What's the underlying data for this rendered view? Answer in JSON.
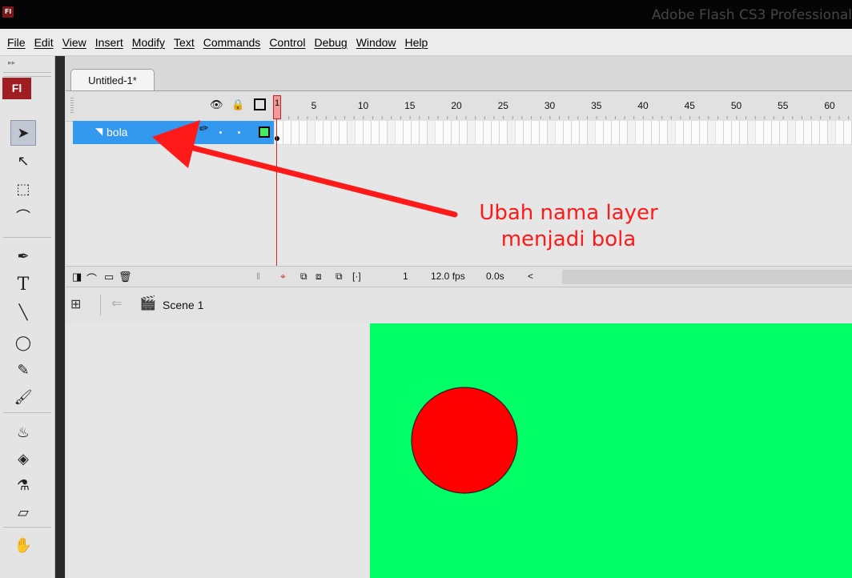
{
  "window": {
    "title": "Adobe Flash CS3 Professional",
    "app_logo": "Fl"
  },
  "menu": {
    "items": [
      "File",
      "Edit",
      "View",
      "Insert",
      "Modify",
      "Text",
      "Commands",
      "Control",
      "Debug",
      "Window",
      "Help"
    ]
  },
  "tools": {
    "logo": "Fl",
    "items": [
      {
        "name": "selection-tool-icon",
        "glyph": "➤",
        "selected": true
      },
      {
        "name": "subselection-tool-icon",
        "glyph": "↖"
      },
      {
        "name": "free-transform-tool-icon",
        "glyph": "⬚"
      },
      {
        "name": "lasso-tool-icon",
        "glyph": "⌒"
      },
      {
        "name": "pen-tool-icon",
        "glyph": "✒"
      },
      {
        "name": "text-tool-icon",
        "glyph": "T"
      },
      {
        "name": "line-tool-icon",
        "glyph": "╲"
      },
      {
        "name": "oval-tool-icon",
        "glyph": "◯"
      },
      {
        "name": "pencil-tool-icon",
        "glyph": "✎"
      },
      {
        "name": "brush-tool-icon",
        "glyph": "🖌"
      },
      {
        "name": "ink-bottle-tool-icon",
        "glyph": "♨"
      },
      {
        "name": "paint-bucket-tool-icon",
        "glyph": "◈"
      },
      {
        "name": "eyedropper-tool-icon",
        "glyph": "⚗"
      },
      {
        "name": "eraser-tool-icon",
        "glyph": "▱"
      },
      {
        "name": "hand-tool-icon",
        "glyph": "✋"
      }
    ]
  },
  "document": {
    "tab_label": "Untitled-1*"
  },
  "timeline": {
    "frame_ticks": [
      "1",
      "5",
      "10",
      "15",
      "20",
      "25",
      "30",
      "35",
      "40",
      "45",
      "50",
      "55",
      "60"
    ],
    "playhead_label": "1",
    "layer": {
      "name": "bola",
      "color": "#40ee60"
    },
    "footer": {
      "current_frame": "1",
      "fps": "12.0 fps",
      "elapsed": "0.0s",
      "scroll_left": "<"
    }
  },
  "editbar": {
    "scene_label": "Scene 1"
  },
  "stage": {
    "background_color": "#00ff66",
    "circle_color": "#ff0000"
  },
  "annotation": {
    "line1": "Ubah nama layer",
    "line2": "menjadi bola",
    "color": "#ff1a1a"
  }
}
